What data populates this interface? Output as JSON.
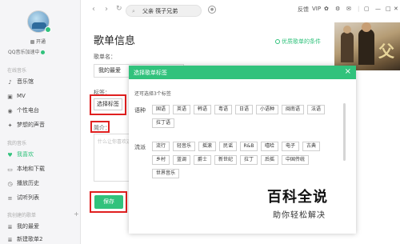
{
  "sidebar": {
    "open_label": "开通",
    "speed_label": "QQ音乐加速中",
    "sections": [
      {
        "title": "在线音乐",
        "items": [
          "音乐馆",
          "MV",
          "个性电台",
          "梦想的声音"
        ]
      },
      {
        "title": "我的音乐",
        "items": [
          "我喜欢",
          "本地和下载",
          "播放历史",
          "试听列表"
        ]
      },
      {
        "title": "我创建的歌单",
        "items": [
          "我的最爱",
          "新建歌单2"
        ]
      }
    ]
  },
  "topbar": {
    "search_value": "父亲 筷子兄弟",
    "feedback": "反馈",
    "vip": "VIP"
  },
  "form": {
    "title": "歌单信息",
    "quality_link": "优质歌单的条件",
    "name_label": "歌单名：",
    "name_value": "我的最爱",
    "tags_label": "标签：",
    "tags_button": "选择标签",
    "intro_label": "简介：",
    "intro_placeholder": "什么让你喜欢这些歌？",
    "save_button": "保存"
  },
  "dialog": {
    "title": "选择歌单标签",
    "close": "×",
    "hint": "还可选择3个标签",
    "categories": [
      {
        "name": "语种",
        "tags": [
          "国语",
          "英语",
          "韩语",
          "粤语",
          "日语",
          "小语种",
          "闽南语",
          "法语",
          "拉丁语"
        ]
      },
      {
        "name": "流派",
        "tags": [
          "流行",
          "轻音乐",
          "摇滚",
          "民谣",
          "R&B",
          "嘻哈",
          "电子",
          "古典",
          "乡村",
          "蓝调",
          "爵士",
          "新世纪",
          "拉丁",
          "后摇",
          "中国传统",
          "世界音乐"
        ]
      }
    ]
  },
  "watermark": {
    "title": "百科全说",
    "subtitle": "助你轻松解决"
  },
  "colors": {
    "accent": "#31c27c",
    "highlight": "#e02020"
  }
}
